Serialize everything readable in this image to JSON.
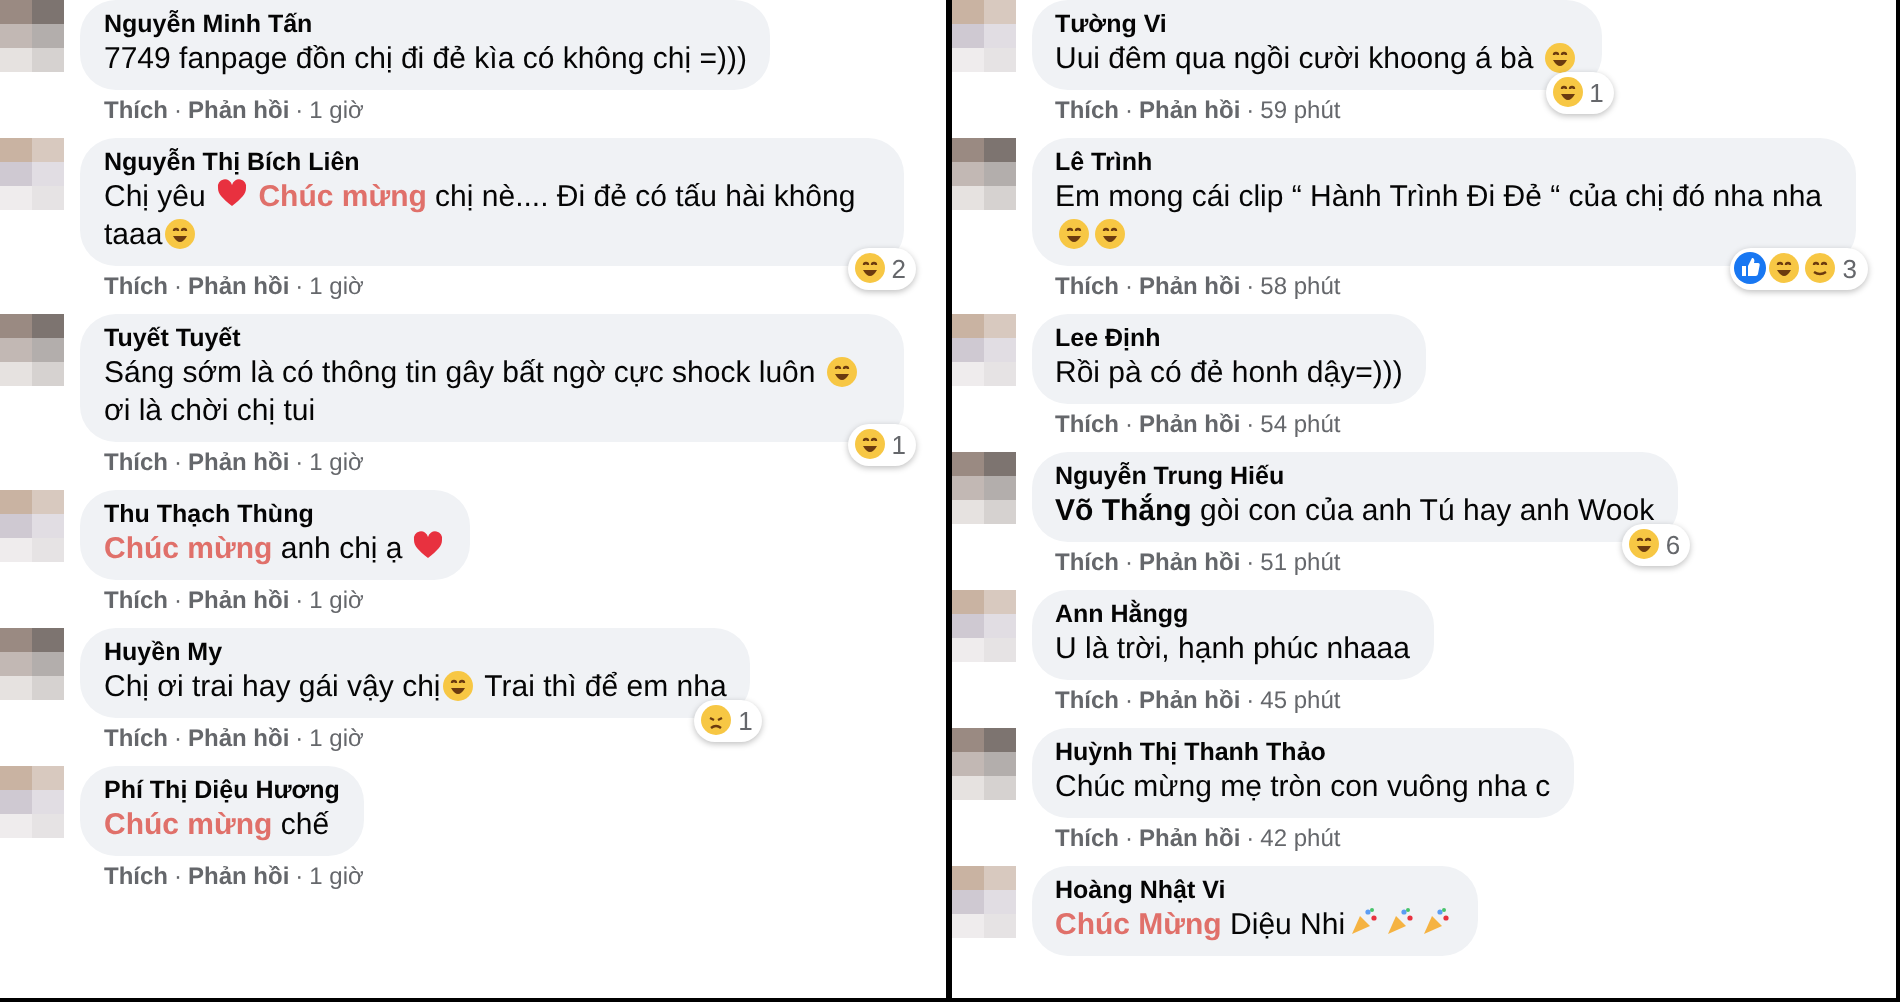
{
  "panels": [
    {
      "comments": [
        {
          "name": "Nguyễn Minh Tấn",
          "body": [
            {
              "kind": "text",
              "text": "7749 fanpage đồn chị đi đẻ kìa có không chị =)))"
            }
          ],
          "like_label": "Thích",
          "separator": "·",
          "reply_label": "Phản hồi",
          "time": "1 giờ"
        },
        {
          "name": "Nguyễn Thị Bích Liên",
          "body": [
            {
              "kind": "text",
              "text": "Chị yêu "
            },
            {
              "kind": "heart"
            },
            {
              "kind": "tag",
              "text": " Chúc mừng"
            },
            {
              "kind": "text",
              "text": " chị nè.... Đi đẻ có tấu hài không taaa"
            },
            {
              "kind": "emoji"
            }
          ],
          "reactions": [
            {
              "kind": "haha"
            }
          ],
          "reaction_count": "2",
          "like_label": "Thích",
          "separator": "·",
          "reply_label": "Phản hồi",
          "time": "1 giờ"
        },
        {
          "name": "Tuyết Tuyết",
          "body": [
            {
              "kind": "text",
              "text": "Sáng sớm là có thông tin gây bất ngờ cực shock luôn "
            },
            {
              "kind": "emoji"
            },
            {
              "kind": "text",
              "text": " ơi là chời chị tui"
            }
          ],
          "reactions": [
            {
              "kind": "haha"
            }
          ],
          "reaction_count": "1",
          "like_label": "Thích",
          "separator": "·",
          "reply_label": "Phản hồi",
          "time": "1 giờ"
        },
        {
          "name": "Thu Thạch Thùng",
          "body": [
            {
              "kind": "tag",
              "text": "Chúc mừng"
            },
            {
              "kind": "text",
              "text": " anh chị ạ "
            },
            {
              "kind": "heart"
            }
          ],
          "like_label": "Thích",
          "separator": "·",
          "reply_label": "Phản hồi",
          "time": "1 giờ"
        },
        {
          "name": "Huyền My",
          "body": [
            {
              "kind": "text",
              "text": "Chị ơi trai hay gái vậy chị"
            },
            {
              "kind": "emoji"
            },
            {
              "kind": "text",
              "text": " Trai thì để em nha"
            }
          ],
          "reactions": [
            {
              "kind": "sad"
            }
          ],
          "reaction_count": "1",
          "like_label": "Thích",
          "separator": "·",
          "reply_label": "Phản hồi",
          "time": "1 giờ"
        },
        {
          "name": "Phí Thị Diệu Hương",
          "body": [
            {
              "kind": "tag",
              "text": "Chúc mừng"
            },
            {
              "kind": "text",
              "text": " chế"
            }
          ],
          "like_label": "Thích",
          "separator": "·",
          "reply_label": "Phản hồi",
          "time": "1 giờ"
        }
      ]
    },
    {
      "comments": [
        {
          "name": "Tường Vi",
          "body": [
            {
              "kind": "text",
              "text": "Uui đêm qua ngồi cười khoong á bà "
            },
            {
              "kind": "emoji"
            }
          ],
          "reactions": [
            {
              "kind": "haha"
            }
          ],
          "reaction_count": "1",
          "like_label": "Thích",
          "separator": "·",
          "reply_label": "Phản hồi",
          "time": "59 phút"
        },
        {
          "name": "Lê Trình",
          "body": [
            {
              "kind": "text",
              "text": "Em mong cái clip “ Hành Trình Đi Đẻ “ của chị đó nha nha "
            },
            {
              "kind": "emoji"
            },
            {
              "kind": "emoji"
            }
          ],
          "reactions": [
            {
              "kind": "like"
            },
            {
              "kind": "haha"
            },
            {
              "kind": "care"
            }
          ],
          "reaction_count": "3",
          "like_label": "Thích",
          "separator": "·",
          "reply_label": "Phản hồi",
          "time": "58 phút"
        },
        {
          "name": "Lee Định",
          "body": [
            {
              "kind": "text",
              "text": "Rồi pà có đẻ honh dậy=)))"
            }
          ],
          "like_label": "Thích",
          "separator": "·",
          "reply_label": "Phản hồi",
          "time": "54 phút"
        },
        {
          "name": "Nguyễn Trung Hiếu",
          "body": [
            {
              "kind": "mention",
              "text": "Võ Thắng"
            },
            {
              "kind": "text",
              "text": " gòi con của anh Tú hay anh Wook"
            }
          ],
          "reactions": [
            {
              "kind": "haha"
            }
          ],
          "reaction_count": "6",
          "like_label": "Thích",
          "separator": "·",
          "reply_label": "Phản hồi",
          "time": "51 phút"
        },
        {
          "name": "Ann Hằngg",
          "body": [
            {
              "kind": "text",
              "text": "U là trời, hạnh phúc nhaaa"
            }
          ],
          "like_label": "Thích",
          "separator": "·",
          "reply_label": "Phản hồi",
          "time": "45 phút"
        },
        {
          "name": "Huỳnh Thị Thanh Thảo",
          "body": [
            {
              "kind": "text",
              "text": "Chúc mừng mẹ tròn con vuông nha c"
            }
          ],
          "like_label": "Thích",
          "separator": "·",
          "reply_label": "Phản hồi",
          "time": "42 phút"
        },
        {
          "name": "Hoàng Nhật Vi",
          "body": [
            {
              "kind": "tag",
              "text": "Chúc Mừng"
            },
            {
              "kind": "text",
              "text": " Diệu Nhi"
            },
            {
              "kind": "party"
            },
            {
              "kind": "party"
            },
            {
              "kind": "party"
            }
          ]
        }
      ]
    }
  ]
}
